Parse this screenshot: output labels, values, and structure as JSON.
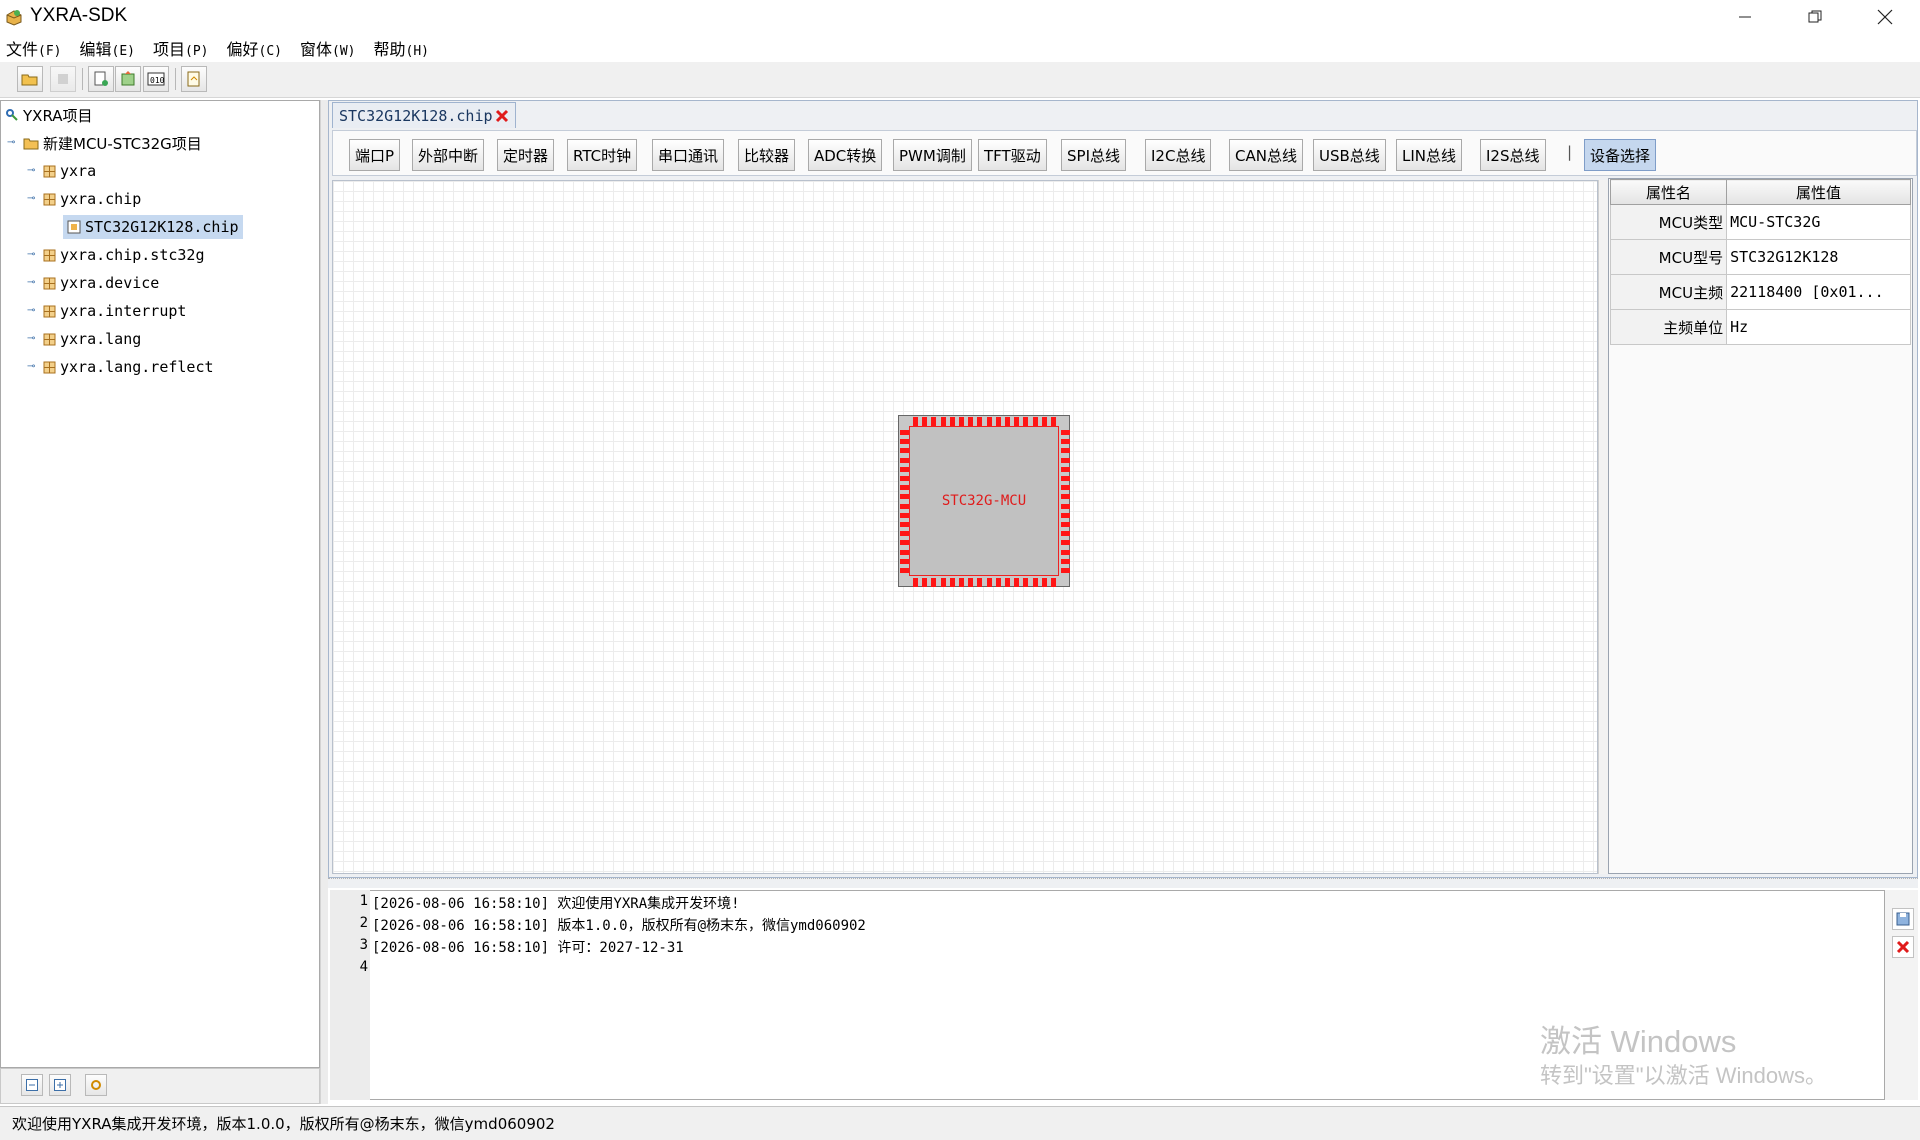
{
  "app": {
    "title": "YXRA-SDK"
  },
  "window_controls": {
    "minimize_icon": "minimize-icon",
    "maximize_icon": "restore-icon",
    "close_icon": "close-icon"
  },
  "menu": [
    {
      "label": "文件",
      "mnemonic": "(F)"
    },
    {
      "label": "编辑",
      "mnemonic": "(E)"
    },
    {
      "label": "项目",
      "mnemonic": "(P)"
    },
    {
      "label": "偏好",
      "mnemonic": "(C)"
    },
    {
      "label": "窗体",
      "mnemonic": "(W)"
    },
    {
      "label": "帮助",
      "mnemonic": "(H)"
    }
  ],
  "toolbar": {
    "icons": [
      "open-folder-icon",
      "stop-icon",
      "new-file-icon",
      "build-icon",
      "binary-icon",
      "export-icon"
    ]
  },
  "tree": {
    "root": "YXRA项目",
    "project": "新建MCU-STC32G项目",
    "packages": [
      "yxra",
      "yxra.chip",
      "yxra.chip.stc32g",
      "yxra.device",
      "yxra.interrupt",
      "yxra.lang",
      "yxra.lang.reflect"
    ],
    "selected_file": "STC32G12K128.chip"
  },
  "editor": {
    "tab_label": "STC32G12K128.chip",
    "components": [
      "端口P",
      "外部中断",
      "定时器",
      "RTC时钟",
      "串口通讯",
      "比较器",
      "ADC转换",
      "PWM调制",
      "TFT驱动",
      "SPI总线",
      "I2C总线",
      "CAN总线",
      "USB总线",
      "LIN总线",
      "I2S总线"
    ],
    "separator": "|",
    "device_select": "设备选择",
    "chip_label": "STC32G-MCU",
    "pin_color": "#ff1515"
  },
  "properties": {
    "header_name": "属性名",
    "header_value": "属性值",
    "rows": [
      {
        "key": "MCU类型",
        "value": "MCU-STC32G"
      },
      {
        "key": "MCU型号",
        "value": "STC32G12K128"
      },
      {
        "key": "MCU主频",
        "value": "22118400 [0x01..."
      },
      {
        "key": "主频单位",
        "value": "Hz"
      }
    ]
  },
  "console": {
    "lines": [
      {
        "no": "1",
        "text": "[2026-08-06 16:58:10] 欢迎使用YXRA集成开发环境!"
      },
      {
        "no": "2",
        "text": "[2026-08-06 16:58:10] 版本1.0.0，版权所有@杨末东，微信ymd060902"
      },
      {
        "no": "3",
        "text": "[2026-08-06 16:58:10] 许可：2027-12-31"
      },
      {
        "no": "4",
        "text": ""
      }
    ]
  },
  "watermark": {
    "line1": "激活 Windows",
    "line2": "转到\"设置\"以激活 Windows。"
  },
  "status": {
    "text": "欢迎使用YXRA集成开发环境，版本1.0.0，版权所有@杨末东，微信ymd060902"
  }
}
